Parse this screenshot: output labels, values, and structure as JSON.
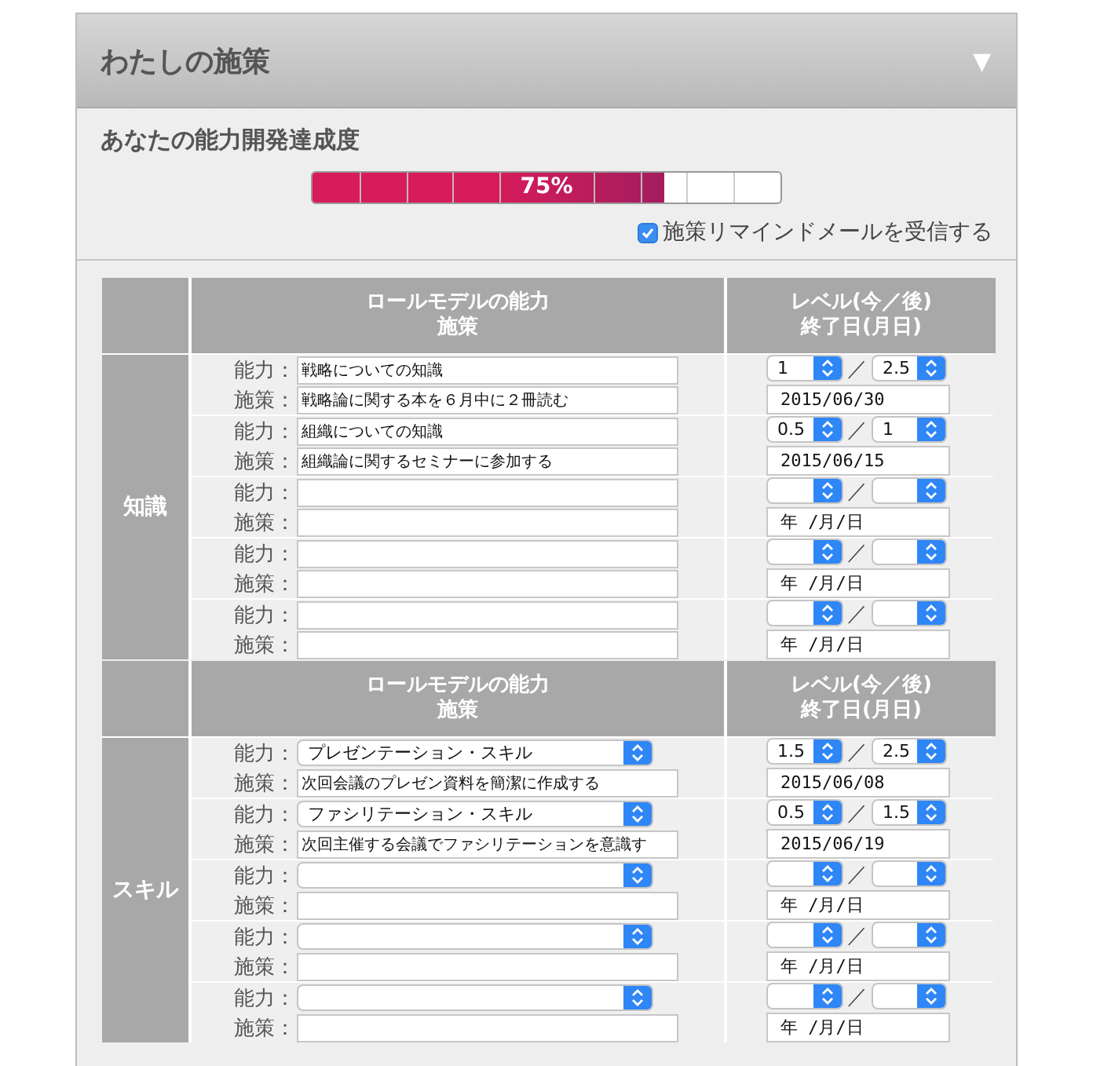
{
  "panel": {
    "title": "わたしの施策",
    "toggle": "▼"
  },
  "progress": {
    "heading": "あなたの能力開発達成度",
    "level": 0.75,
    "label": "75%"
  },
  "reminder": {
    "label": "施策リマインドメールを受信する",
    "checked": true
  },
  "sections": [
    {
      "name": "知識",
      "kind": "text",
      "header": {
        "col1_line1": "ロールモデルの能力",
        "col1_line2": "施策",
        "col2_line1": "レベル(今／後)",
        "col2_line2": "終了日(月日)"
      },
      "items": [
        {
          "ability_label": "能力：",
          "ability": "戦略についての知識",
          "policy_label": "施策：",
          "policy": "戦略論に関する本を６月中に２冊読む",
          "level_now": "1",
          "separator": "／",
          "level_after": "2.5",
          "date": "2015/06/30"
        },
        {
          "ability_label": "能力：",
          "ability": "組織についての知識",
          "policy_label": "施策：",
          "policy": "組織論に関するセミナーに参加する",
          "level_now": "0.5",
          "separator": "／",
          "level_after": "1",
          "date": "2015/06/15"
        },
        {
          "ability_label": "能力：",
          "policy_label": "施策：",
          "separator": "／",
          "date_placeholder": "年 /月/日"
        },
        {
          "ability_label": "能力：",
          "policy_label": "施策：",
          "separator": "／",
          "date_placeholder": "年 /月/日"
        },
        {
          "ability_label": "能力：",
          "policy_label": "施策：",
          "separator": "／",
          "date_placeholder": "年 /月/日"
        }
      ]
    },
    {
      "name": "スキル",
      "kind": "select",
      "header": {
        "col1_line1": "ロールモデルの能力",
        "col1_line2": "施策",
        "col2_line1": "レベル(今／後)",
        "col2_line2": "終了日(月日)"
      },
      "items": [
        {
          "ability_label": "能力：",
          "ability": "プレゼンテーション・スキル",
          "policy_label": "施策：",
          "policy": "次回会議のプレゼン資料を簡潔に作成する",
          "level_now": "1.5",
          "separator": "／",
          "level_after": "2.5",
          "date": "2015/06/08"
        },
        {
          "ability_label": "能力：",
          "ability": "ファシリテーション・スキル",
          "policy_label": "施策：",
          "policy": "次回主催する会議でファシリテーションを意識す",
          "level_now": "0.5",
          "separator": "／",
          "level_after": "1.5",
          "date": "2015/06/19"
        },
        {
          "ability_label": "能力：",
          "policy_label": "施策：",
          "separator": "／",
          "date_placeholder": "年 /月/日"
        },
        {
          "ability_label": "能力：",
          "policy_label": "施策：",
          "separator": "／",
          "date_placeholder": "年 /月/日"
        },
        {
          "ability_label": "能力：",
          "policy_label": "施策：",
          "separator": "／",
          "date_placeholder": "年 /月/日"
        }
      ]
    }
  ]
}
